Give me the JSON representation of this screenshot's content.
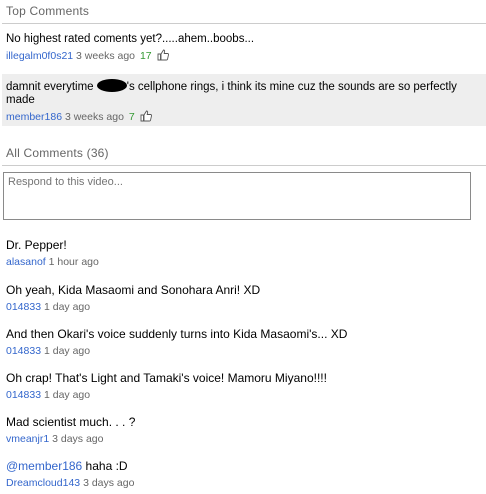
{
  "top_comments": {
    "heading": "Top Comments",
    "items": [
      {
        "text": "No highest rated coments yet?.....ahem..boobs...",
        "user": "illegalm0f0s21",
        "time": "3 weeks ago",
        "likes": "17"
      },
      {
        "text_before": "damnit everytime ",
        "text_after": "'s cellphone rings, i think its mine cuz the sounds are so perfectly made",
        "user": "member186",
        "time": "3 weeks ago",
        "likes": "7"
      }
    ]
  },
  "all_comments": {
    "heading": "All Comments (36)",
    "respond_placeholder": "Respond to this video...",
    "items": [
      {
        "text": "Dr. Pepper!",
        "user": "alasanof",
        "time": "1 hour ago"
      },
      {
        "text": "Oh yeah, Kida Masaomi and Sonohara Anri! XD",
        "user": "014833",
        "time": "1 day ago"
      },
      {
        "text": "And then Okari's voice suddenly turns into Kida Masaomi's... XD",
        "user": "014833",
        "time": "1 day ago"
      },
      {
        "text": "Oh crap! That's Light and Tamaki's voice! Mamoru Miyano!!!!",
        "user": "014833",
        "time": "1 day ago"
      },
      {
        "text": "Mad scientist much. . . ?",
        "user": "vmeanjr1",
        "time": "3 days ago"
      },
      {
        "mention": "@member186",
        "text": " haha :D",
        "user": "Dreamcloud143",
        "time": "3 days ago"
      }
    ]
  },
  "icons": {
    "like": "thumbs-up-icon",
    "redaction": "redaction-blob"
  }
}
